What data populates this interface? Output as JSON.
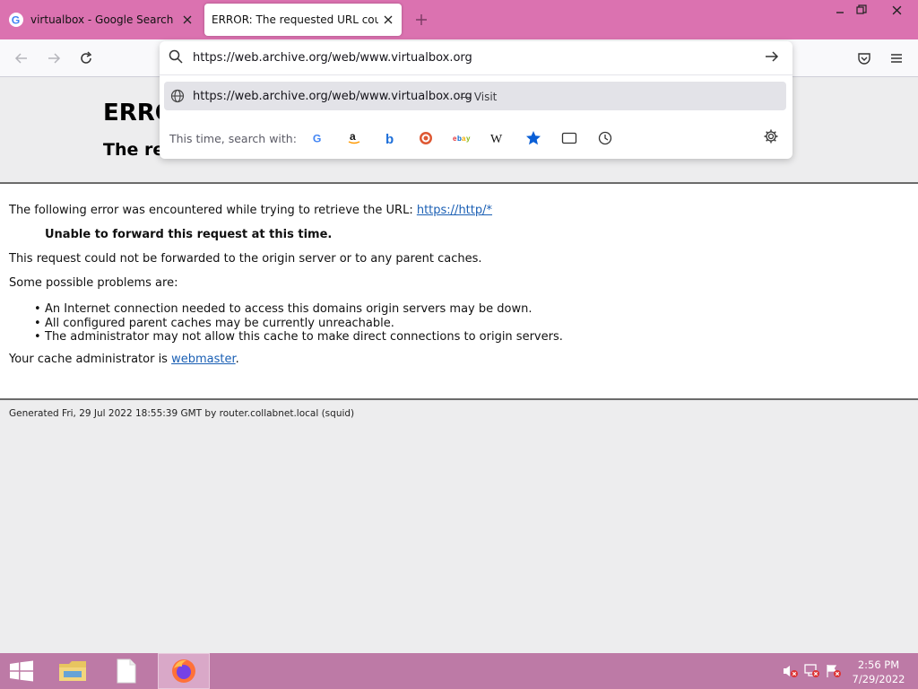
{
  "browser": {
    "tabs": [
      {
        "label": "virtualbox - Google Search",
        "favicon": "google-icon",
        "active": false
      },
      {
        "label": "ERROR: The requested URL could not be retrieved",
        "favicon": "none",
        "active": true
      }
    ]
  },
  "urlbar": {
    "value": "https://web.archive.org/web/www.virtualbox.org",
    "suggestion": {
      "url": "https://web.archive.org/web/www.virtualbox.org",
      "action": "— Visit"
    },
    "search_with_label": "This time, search with:",
    "engines": [
      "google-icon",
      "amazon-icon",
      "bing-icon",
      "duckduckgo-icon",
      "ebay-icon",
      "wikipedia-icon",
      "bookmarks-star-icon",
      "tabs-icon",
      "history-icon"
    ]
  },
  "page": {
    "title": "ERROR",
    "subtitle": "The re",
    "line1": "The following error was encountered while trying to retrieve the URL: ",
    "line1_link": "https://http/*",
    "strong": "Unable to forward this request at this time.",
    "line2": "This request could not be forwarded to the origin server or to any parent caches.",
    "line3": "Some possible problems are:",
    "problems": [
      "An Internet connection needed to access this domains origin servers may be down.",
      "All configured parent caches may be currently unreachable.",
      "The administrator may not allow this cache to make direct connections to origin servers."
    ],
    "admin_prefix": "Your cache administrator is ",
    "admin_link": "webmaster",
    "admin_suffix": ".",
    "footer": "Generated Fri, 29 Jul 2022 18:55:39 GMT by router.collabnet.local (squid)"
  },
  "taskbar": {
    "time": "2:56 PM",
    "date": "7/29/2022"
  },
  "colors": {
    "titlebar": "#db72b0",
    "taskbar": "#bd7aa6",
    "link": "#1a5fb4"
  }
}
